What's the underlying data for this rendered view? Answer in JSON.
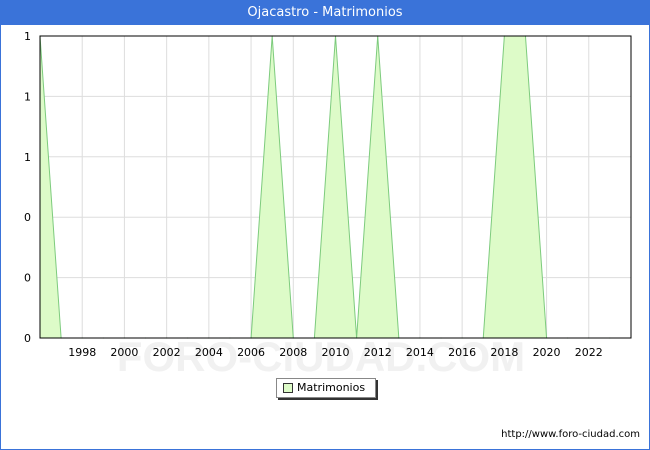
{
  "title": "Ojacastro - Matrimonios",
  "source_url": "http://www.foro-ciudad.com",
  "watermark": "FORO-CIUDAD.COM",
  "colors": {
    "titlebar": "#3a73d9",
    "area_fill": "#ddfbc8",
    "area_line": "#7dcb7d",
    "grid": "#dddddd"
  },
  "chart_data": {
    "type": "area",
    "title": "Ojacastro - Matrimonios",
    "xlabel": "",
    "ylabel": "",
    "xlim": [
      1996,
      2024
    ],
    "ylim": [
      0,
      1
    ],
    "grid": true,
    "legend_position": "bottom",
    "x_ticks": [
      "1998",
      "2000",
      "2002",
      "2004",
      "2006",
      "2008",
      "2010",
      "2012",
      "2014",
      "2016",
      "2018",
      "2020",
      "2022"
    ],
    "y_tick_labels": [
      "0",
      "0",
      "0",
      "1",
      "1",
      "1"
    ],
    "series": [
      {
        "name": "Matrimonios",
        "x": [
          1996,
          1997,
          1998,
          1999,
          2000,
          2001,
          2002,
          2003,
          2004,
          2005,
          2006,
          2007,
          2008,
          2009,
          2010,
          2011,
          2012,
          2013,
          2014,
          2015,
          2016,
          2017,
          2018,
          2019,
          2020,
          2021,
          2022,
          2023
        ],
        "values": [
          1,
          0,
          0,
          0,
          0,
          0,
          0,
          0,
          0,
          0,
          0,
          1,
          0,
          0,
          1,
          0,
          1,
          0,
          0,
          0,
          0,
          0,
          1,
          1,
          0,
          0,
          0,
          0
        ]
      }
    ]
  }
}
